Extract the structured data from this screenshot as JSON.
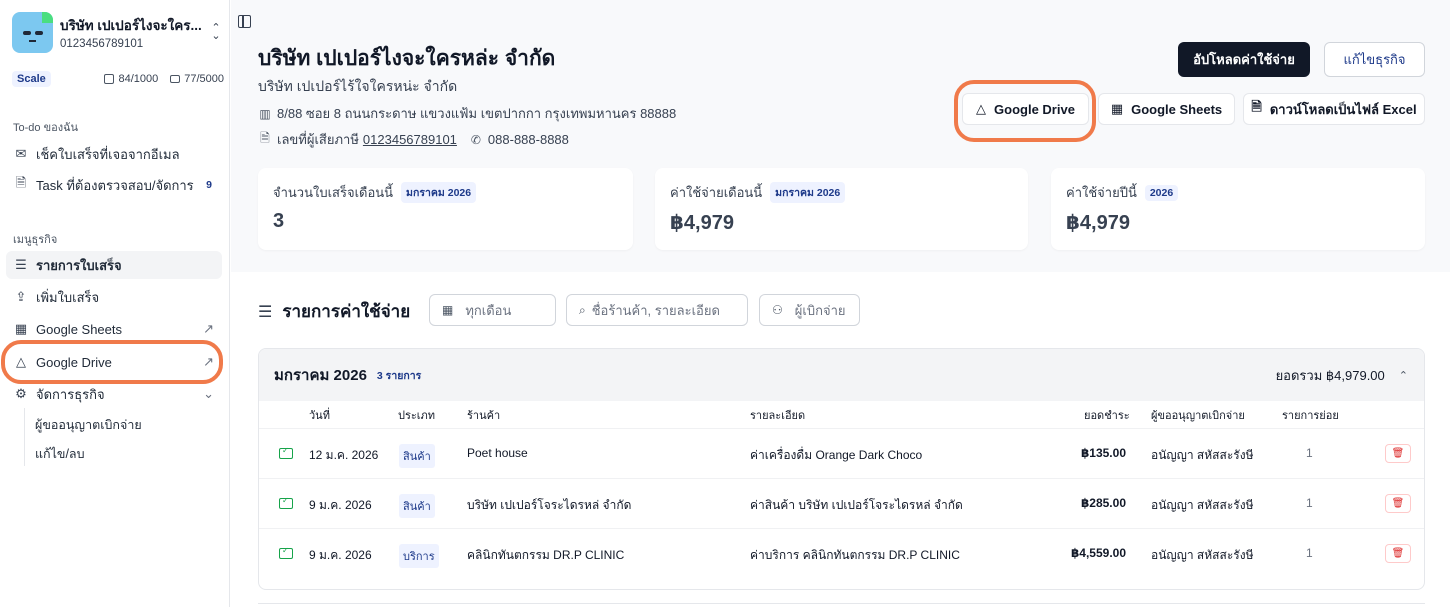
{
  "sidebar": {
    "company_name": "บริษัท เปเปอร์ไงจะใคร...",
    "company_id": "0123456789101",
    "plan": "Scale",
    "quota_docs": "84/1000",
    "quota_mail": "77/5000",
    "todo_title": "To-do ของฉัน",
    "todo_items": [
      {
        "label": "เช็คใบเสร็จที่เจอจากอีเมล",
        "icon": "mail-icon"
      },
      {
        "label": "Task ที่ต้องตรวจสอบ/จัดการ",
        "icon": "file-icon",
        "count": "9"
      }
    ],
    "menu_title": "เมนูธุรกิจ",
    "menu_items": [
      {
        "label": "รายการใบเสร็จ",
        "icon": "list-icon"
      },
      {
        "label": "เพิ่มใบเสร็จ",
        "icon": "upload-icon"
      },
      {
        "label": "Google Sheets",
        "icon": "sheet-icon"
      },
      {
        "label": "Google Drive",
        "icon": "drive-icon"
      },
      {
        "label": "จัดการธุรกิจ",
        "icon": "gear-icon"
      }
    ],
    "sub_items": [
      "ผู้ขออนุญาตเบิกจ่าย",
      "แก้ไข/ลบ"
    ]
  },
  "header": {
    "title": "บริษัท เปเปอร์ไงจะใครหล่ะ จำกัด",
    "subtitle": "บริษัท เปเปอร์ไร้ใจใครหน่ะ จำกัด",
    "address": "8/88 ซอย 8 ถนนกระดาษ แขวงแฟ้ม เขตปากกา กรุงเทพมหานคร 88888",
    "tax_label": "เลขที่ผู้เสียภาษี",
    "tax_id": "0123456789101",
    "phone": "088-888-8888",
    "upload_btn": "อัปโหลดค่าใช้จ่าย",
    "edit_btn": "แก้ไขธุรกิจ",
    "drive_btn": "Google Drive",
    "sheets_btn": "Google Sheets",
    "excel_btn": "ดาวน์โหลดเป็นไฟล์ Excel"
  },
  "stats": [
    {
      "label": "จำนวนใบเสร็จเดือนนี้",
      "tag": "มกราคม 2026",
      "value": "3"
    },
    {
      "label": "ค่าใช้จ่ายเดือนนี้",
      "tag": "มกราคม 2026",
      "value": "฿4,979"
    },
    {
      "label": "ค่าใช้จ่ายปีนี้",
      "tag": "2026",
      "value": "฿4,979"
    }
  ],
  "expenses": {
    "title": "รายการค่าใช้จ่าย",
    "filter_month": "ทุกเดือน",
    "filter_search_placeholder": "ชื่อร้านค้า, รายละเอียด",
    "filter_payer": "ผู้เบิกจ่าย",
    "group_title": "มกราคม 2026",
    "group_count": "3 รายการ",
    "group_total": "ยอดรวม ฿4,979.00",
    "columns": [
      "วันที่",
      "ประเภท",
      "ร้านค้า",
      "รายละเอียด",
      "ยอดชำระ",
      "ผู้ขออนุญาตเบิกจ่าย",
      "รายการย่อย"
    ],
    "rows": [
      {
        "date": "12 ม.ค. 2026",
        "type": "สินค้า",
        "shop": "Poet house",
        "detail": "ค่าเครื่องดื่ม Orange Dark Choco",
        "amount": "฿135.00",
        "payer": "อนัญญา สหัสสะรังษี",
        "items": "1"
      },
      {
        "date": "9 ม.ค. 2026",
        "type": "สินค้า",
        "shop": "บริษัท เปเปอร์โจระไดรหล่ จำกัด",
        "detail": "ค่าสินค้า บริษัท เปเปอร์โจระไดรหล่ จำกัด",
        "amount": "฿285.00",
        "payer": "อนัญญา สหัสสะรังษี",
        "items": "1"
      },
      {
        "date": "9 ม.ค. 2026",
        "type": "บริการ",
        "shop": "คลินิกทันตกรรม DR.P CLINIC",
        "detail": "ค่าบริการ คลินิกทันตกรรม DR.P CLINIC",
        "amount": "฿4,559.00",
        "payer": "อนัญญา สหัสสะรังษี",
        "items": "1"
      }
    ]
  },
  "colors": {
    "accent_ring": "#f07a4a",
    "dark_button": "#111827",
    "badge_text": "#1e3a8a"
  }
}
